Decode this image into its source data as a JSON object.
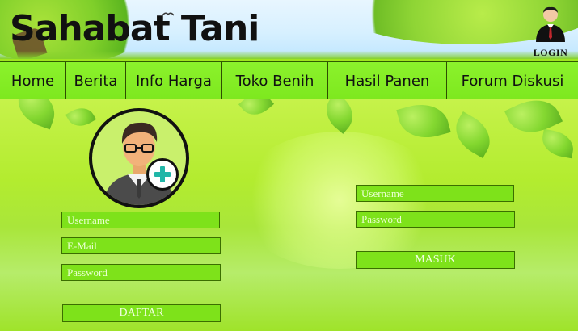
{
  "header": {
    "title": "Sahabat Tani",
    "login_label": "LOGIN",
    "login_icon": "user-icon"
  },
  "nav": {
    "items": [
      {
        "label": "Home"
      },
      {
        "label": "Berita"
      },
      {
        "label": "Info Harga"
      },
      {
        "label": "Toko Benih"
      },
      {
        "label": "Hasil Panen"
      },
      {
        "label": "Forum Diskusi"
      }
    ]
  },
  "register": {
    "avatar_icon": "add-user-icon",
    "username_placeholder": "Username",
    "email_placeholder": "E-Mail",
    "password_placeholder": "Password",
    "submit_label": "DAFTAR"
  },
  "login_form": {
    "username_placeholder": "Username",
    "password_placeholder": "Password",
    "submit_label": "MASUK"
  },
  "colors": {
    "nav_bg": "#7de81e",
    "field_bg": "#7ee21a",
    "field_border": "#3b6e00",
    "plus_accent": "#21b6a8"
  }
}
